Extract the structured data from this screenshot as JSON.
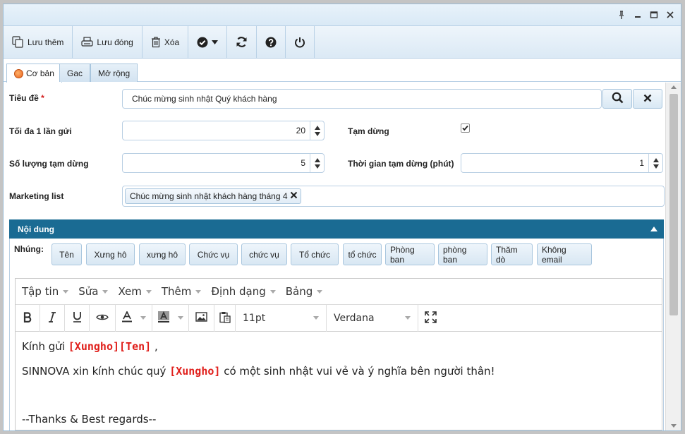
{
  "toolbar": {
    "save_more": "Lưu thêm",
    "save_close": "Lưu đóng",
    "delete": "Xóa"
  },
  "tabs": [
    {
      "label": "Cơ bản"
    },
    {
      "label": "Gac"
    },
    {
      "label": "Mở rộng"
    }
  ],
  "form": {
    "title_label": "Tiêu đề",
    "title_required": "*",
    "title_value": "Chúc mừng sinh nhật Quý khách hàng",
    "max_send_label": "Tối đa 1 lần gửi",
    "max_send_value": "20",
    "pause_label": "Tạm dừng",
    "pause_checked": true,
    "pause_count_label": "Số lượng tạm dừng",
    "pause_count_value": "5",
    "pause_time_label": "Thời gian tạm dừng (phút)",
    "pause_time_value": "1",
    "marketing_label": "Marketing list",
    "marketing_tag": "Chúc mừng sinh nhật khách hàng tháng 4"
  },
  "panel": {
    "title": "Nội dung",
    "embed_label": "Nhúng:",
    "embed_buttons": [
      "Tên",
      "Xưng hô",
      "xưng hô",
      "Chức vụ",
      "chức vụ",
      "Tổ chức",
      "tổ chức",
      "Phòng ban",
      "phòng ban",
      "Thăm dò",
      "Không email"
    ]
  },
  "editor": {
    "menus": [
      "Tập tin",
      "Sửa",
      "Xem",
      "Thêm",
      "Định dạng",
      "Bảng"
    ],
    "font_size": "11pt",
    "font_family": "Verdana",
    "line1_text": "Kính gửi",
    "line1_merge": "[Xungho][Ten]",
    "line1_tail": " ,",
    "line2_text": "SINNOVA xin kính chúc quý",
    "line2_merge": "[Xungho]",
    "line2_tail": "  có một sinh nhật vui vẻ và ý nghĩa bên người thân!",
    "line3": "--Thanks & Best regards--"
  },
  "colors": {
    "accent": "#1a6b93",
    "merge": "#e0201c"
  }
}
